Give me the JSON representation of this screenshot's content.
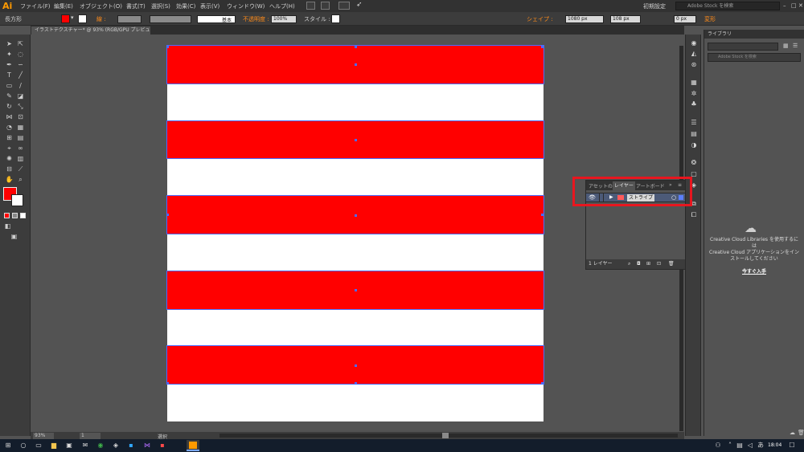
{
  "app": {
    "logo": "Ai",
    "menus": [
      "ファイル(F)",
      "編集(E)",
      "オブジェクト(O)",
      "書式(T)",
      "選択(S)",
      "効果(C)",
      "表示(V)",
      "ウィンドウ(W)",
      "ヘルプ(H)"
    ],
    "workspace": "初期設定",
    "stock_search_placeholder": "Adobe Stock を検索"
  },
  "control_bar": {
    "object_type": "長方形",
    "stroke_label": "線 :",
    "stroke_profile": "基本",
    "opacity_label": "不透明度 :",
    "opacity_value": "100%",
    "style_label": "スタイル :",
    "shape_label": "シェイプ :",
    "width_value": "1080 px",
    "height_value": "108 px",
    "corner_value": "0 px",
    "transform_label": "変形"
  },
  "document": {
    "tab_title": "イラストテクスチャー* @ 93% (RGB/GPU プレビュー)",
    "zoom": "93%",
    "page": "1",
    "status": "選択"
  },
  "artboard": {
    "background": "#ffffff",
    "stripe_color": "#ff0000",
    "stripe_count": 5
  },
  "layers_panel": {
    "tabs": [
      "アセットの書き",
      "レイヤー",
      "アートボード"
    ],
    "active_tab": "レイヤー",
    "layer_name": "ストライプ",
    "footer_count": "1 レイヤー"
  },
  "libraries_panel": {
    "title": "ライブラリ",
    "search_placeholder": "Adobe Stock を検索",
    "message_line1": "Creative Cloud Libraries を使用するに",
    "message_line2": "は",
    "message_line3": "Creative Cloud アプリケーションをイン",
    "message_line4": "ストールしてください",
    "install_link": "今すぐ入手"
  },
  "taskbar": {
    "language": "あ",
    "time": "18:04"
  },
  "colors": {
    "fill": "#ff0000",
    "accent_highlight": "#e8161f",
    "selection": "#4a6cff"
  }
}
